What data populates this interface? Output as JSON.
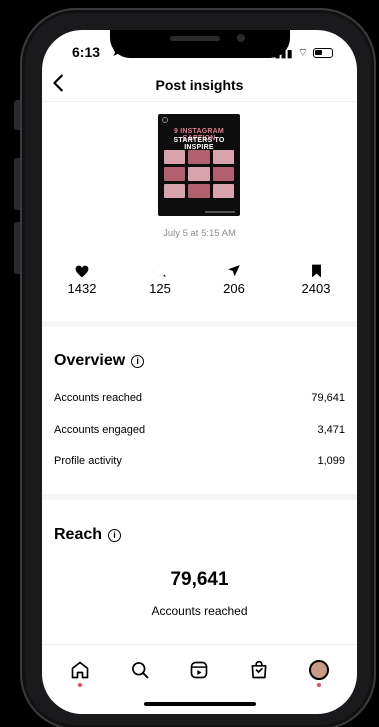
{
  "status_bar": {
    "time": "6:13"
  },
  "header": {
    "title": "Post insights"
  },
  "post": {
    "thumbnail_line1": "9 INSTAGRAM CAPTION",
    "thumbnail_line2": "STARTERS TO INSPIRE",
    "date": "July 5 at 5:15 AM"
  },
  "stats": [
    {
      "icon": "heart-icon",
      "value": "1432"
    },
    {
      "icon": "comment-icon",
      "value": "125"
    },
    {
      "icon": "share-icon",
      "value": "206"
    },
    {
      "icon": "bookmark-icon",
      "value": "2403"
    }
  ],
  "overview": {
    "title": "Overview",
    "rows": [
      {
        "label": "Accounts reached",
        "value": "79,641"
      },
      {
        "label": "Accounts engaged",
        "value": "3,471"
      },
      {
        "label": "Profile activity",
        "value": "1,099"
      }
    ]
  },
  "reach": {
    "title": "Reach",
    "value": "79,641",
    "label": "Accounts reached"
  },
  "tabbar": {
    "items": [
      "home-icon",
      "search-icon",
      "reels-icon",
      "shop-icon",
      "profile-avatar"
    ]
  }
}
